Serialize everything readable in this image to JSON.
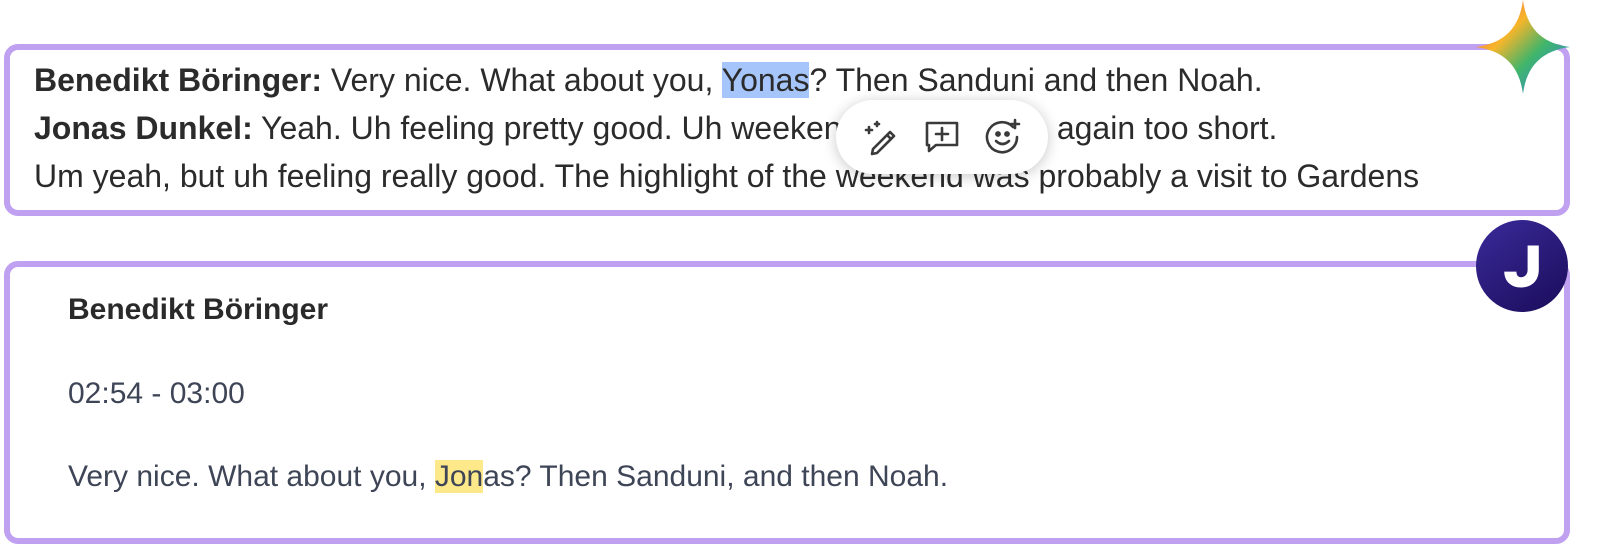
{
  "transcript_panel": {
    "lines": [
      {
        "speaker": "Benedikt Böringer:",
        "text_before": " Very nice. What about you, ",
        "selected": "Yonas",
        "text_after": "? Then Sanduni and then Noah."
      },
      {
        "speaker": "Jonas Dunkel:",
        "text": " Yeah. Uh feeling pretty good. Uh weekend uh was once again too short."
      },
      {
        "text": "Um yeah, but uh feeling really good. The highlight of the weekend was probably a visit to Gardens"
      }
    ],
    "toolbar": {
      "icons": [
        "magic-pen-icon",
        "add-comment-icon",
        "add-emoji-icon"
      ]
    }
  },
  "segment_panel": {
    "speaker": "Benedikt Böringer",
    "time_range": "02:54 - 03:00",
    "text_highlight": "Jon",
    "text_rest": "as? Then Sanduni, and then Noah.",
    "text_prefix": "Very nice. What about you, "
  },
  "badges": {
    "top": "gemini-sparkle-icon",
    "bottom": "jamie-logo-icon"
  },
  "colors": {
    "panel_border": "#c0a0f0",
    "selection": "#a5c5fb",
    "match_highlight": "#fde88a",
    "jamie_bg": "#2a1a7a"
  }
}
